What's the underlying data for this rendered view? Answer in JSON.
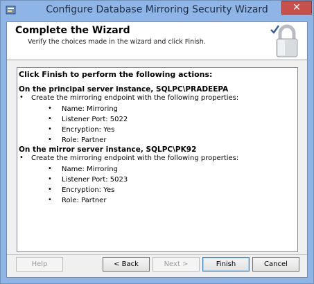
{
  "window": {
    "title": "Configure Database Mirroring Security Wizard",
    "close_glyph": "✕"
  },
  "header": {
    "title": "Complete the Wizard",
    "subtitle": "Verify the choices made in the wizard and click Finish."
  },
  "summary": {
    "heading": "Click Finish to perform the following actions:",
    "principal": {
      "title": "On the principal server instance, SQLPC\\PRADEEPA",
      "action": "Create the mirroring endpoint with the following properties:",
      "props": [
        "Name: Mirroring",
        "Listener Port: 5022",
        "Encryption: Yes",
        "Role: Partner"
      ]
    },
    "mirror": {
      "title": "On the mirror server instance, SQLPC\\PK92",
      "action": "Create the mirroring endpoint with the following properties:",
      "props": [
        "Name: Mirroring",
        "Listener Port: 5023",
        "Encryption: Yes",
        "Role: Partner"
      ]
    },
    "bullet": "•"
  },
  "buttons": {
    "help": "Help",
    "back": "< Back",
    "next": "Next >",
    "finish": "Finish",
    "cancel": "Cancel"
  },
  "colors": {
    "titlebar": "#8fb5e6",
    "close": "#c7504a"
  }
}
